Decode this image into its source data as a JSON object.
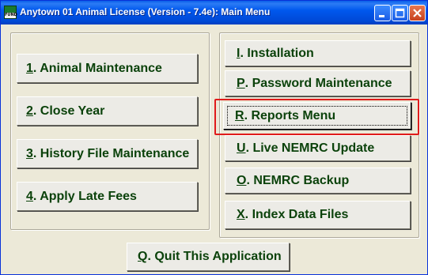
{
  "window": {
    "title": "Anytown 01 Animal License (Version - 7.4e):  Main Menu",
    "icon_label": "FUND"
  },
  "left_menu": [
    {
      "key": "1",
      "label": ". Animal Maintenance"
    },
    {
      "key": "2",
      "label": ".  Close Year"
    },
    {
      "key": "3",
      "label": ". History File Maintenance"
    },
    {
      "key": "4",
      "label": ".  Apply Late Fees"
    }
  ],
  "right_menu": [
    {
      "key": "I",
      "label": ".  Installation"
    },
    {
      "key": "P",
      "label": ".  Password Maintenance"
    },
    {
      "key": "R",
      "label": ".  Reports Menu"
    },
    {
      "key": "U",
      "label": ". Live NEMRC Update"
    },
    {
      "key": "O",
      "label": ". NEMRC Backup"
    },
    {
      "key": "X",
      "label": ".  Index Data Files"
    }
  ],
  "quit": {
    "key": "Q",
    "label": ".  Quit This Application"
  }
}
